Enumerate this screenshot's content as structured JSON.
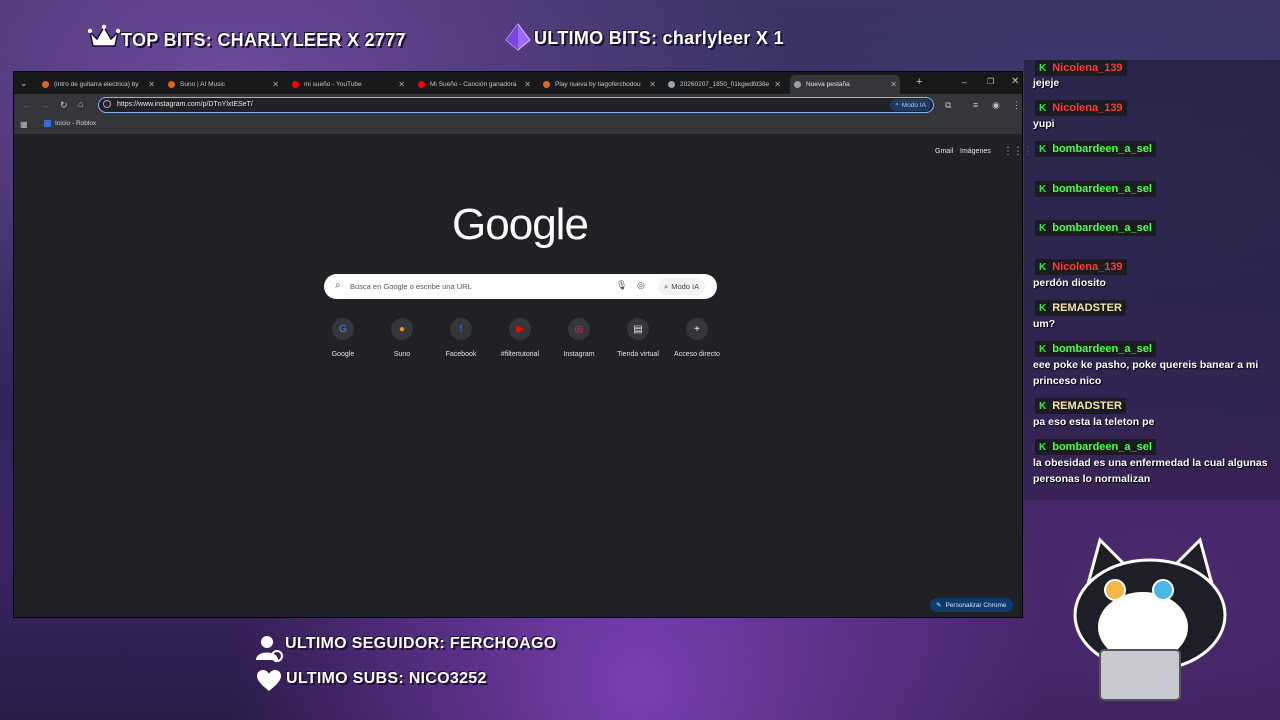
{
  "overlay": {
    "top_bits": "TOP BITS: CHARLYLEER X 2777",
    "ultimo_bits": "ULTIMO BITS: charlyleer X 1",
    "ultimo_seguidor": "ULTIMO SEGUIDOR: FERCHOAGO",
    "ultimo_subs": "ULTIMO SUBS: NICO3252",
    "accent": "#9b6bff"
  },
  "browser": {
    "tabs": [
      {
        "label": "(intro de guitarra electrica) by",
        "favicon_color": "#e8611a"
      },
      {
        "label": "Suno | AI Music",
        "favicon_color": "#e8611a"
      },
      {
        "label": "mi sueño - YouTube",
        "favicon_color": "#ff0000"
      },
      {
        "label": "Mi Sueño - Canción ganadora",
        "favicon_color": "#ff0000"
      },
      {
        "label": "Play nueva by tiagoferchodou",
        "favicon_color": "#e8611a"
      },
      {
        "label": "20260207_1850_01kgwdfd38e",
        "favicon_color": "#9aa0a6"
      },
      {
        "label": "Nueva pestaña",
        "favicon_color": "#9aa0a6"
      }
    ],
    "new_tab_symbol": "+",
    "url": "https://www.instagram.com/p/DTnYlxtESeT/",
    "modo_ia_label": "Modo IA",
    "bookmark": "Inicio - Roblox"
  },
  "ntp": {
    "gmail": "Gmail",
    "imagenes": "Imágenes",
    "logo": "Google",
    "search_placeholder": "Busca en Google o escribe una URL",
    "modo_ia": "Modo IA",
    "shortcuts": [
      {
        "label": "Google",
        "icon": "google-icon"
      },
      {
        "label": "Suno",
        "icon": "suno-icon"
      },
      {
        "label": "Facebook",
        "icon": "facebook-icon"
      },
      {
        "label": "#filtertutorial",
        "icon": "youtube-icon"
      },
      {
        "label": "Instagram",
        "icon": "instagram-icon"
      },
      {
        "label": "Tienda virtual",
        "icon": "store-icon"
      },
      {
        "label": "Acceso directo",
        "icon": "plus-icon"
      }
    ],
    "personalize": "Personalizar Chrome"
  },
  "chat": [
    {
      "user": "Nicolena_139",
      "user_color": "#ff3b3b",
      "message": "jejeje"
    },
    {
      "user": "Nicolena_139",
      "user_color": "#ff3b3b",
      "message": "yupi"
    },
    {
      "user": "bombardeen_a_sel",
      "user_color": "#4dff4d",
      "message": ""
    },
    {
      "user": "bombardeen_a_sel",
      "user_color": "#4dff4d",
      "message": ""
    },
    {
      "user": "bombardeen_a_sel",
      "user_color": "#4dff4d",
      "message": ""
    },
    {
      "user": "Nicolena_139",
      "user_color": "#ff3b3b",
      "message": "perdón diosito"
    },
    {
      "user": "REMADSTER",
      "user_color": "#f5e2a8",
      "message": "um?"
    },
    {
      "user": "bombardeen_a_sel",
      "user_color": "#4dff4d",
      "message": "eee poke ke pasho, poke quereis banear a mi princeso nico"
    },
    {
      "user": "REMADSTER",
      "user_color": "#f5e2a8",
      "message": "pa eso esta la teleton pe"
    },
    {
      "user": "bombardeen_a_sel",
      "user_color": "#4dff4d",
      "message": "la obesidad es una enfermedad la cual algunas personas lo normalizan"
    }
  ]
}
